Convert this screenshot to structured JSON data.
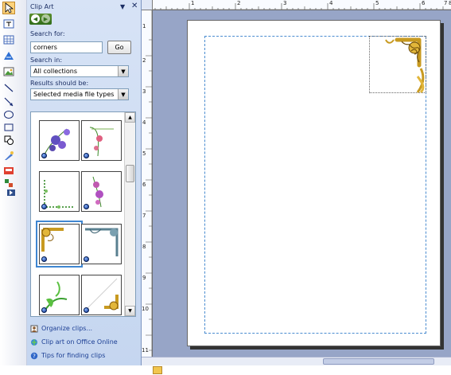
{
  "task_pane": {
    "title": "Clip Art",
    "menu_glyph": "▼",
    "close_glyph": "✕",
    "search_label": "Search for:",
    "search_value": "corners",
    "go_label": "Go",
    "search_in_label": "Search in:",
    "search_in_value": "All collections",
    "results_label": "Results should be:",
    "results_value": "Selected media file types",
    "links": [
      {
        "label": "Organize clips...",
        "icon": "organize-clips-icon"
      },
      {
        "label": "Clip art on Office Online",
        "icon": "office-online-icon"
      },
      {
        "label": "Tips for finding clips",
        "icon": "help-icon"
      }
    ]
  },
  "ruler": {
    "h_numbers": [
      "1",
      "2",
      "3",
      "4",
      "5",
      "6",
      "7",
      "8"
    ],
    "v_numbers": [
      "1",
      "2",
      "3",
      "4",
      "5",
      "6",
      "7",
      "8",
      "9",
      "10",
      "11"
    ]
  },
  "colors": {
    "accent": "#3f86d1",
    "pane_bg": "#d7e3f6",
    "workspace_bg": "#97a5c7"
  },
  "toolbar_icons": [
    "pointer-icon",
    "text-box-icon",
    "table-icon",
    "wordart-icon",
    "picture-icon",
    "line-icon",
    "arrow-icon",
    "oval-icon",
    "rectangle-icon",
    "autoshapes-icon",
    "hotspot-icon",
    "design-gallery-icon",
    "item-icon"
  ]
}
